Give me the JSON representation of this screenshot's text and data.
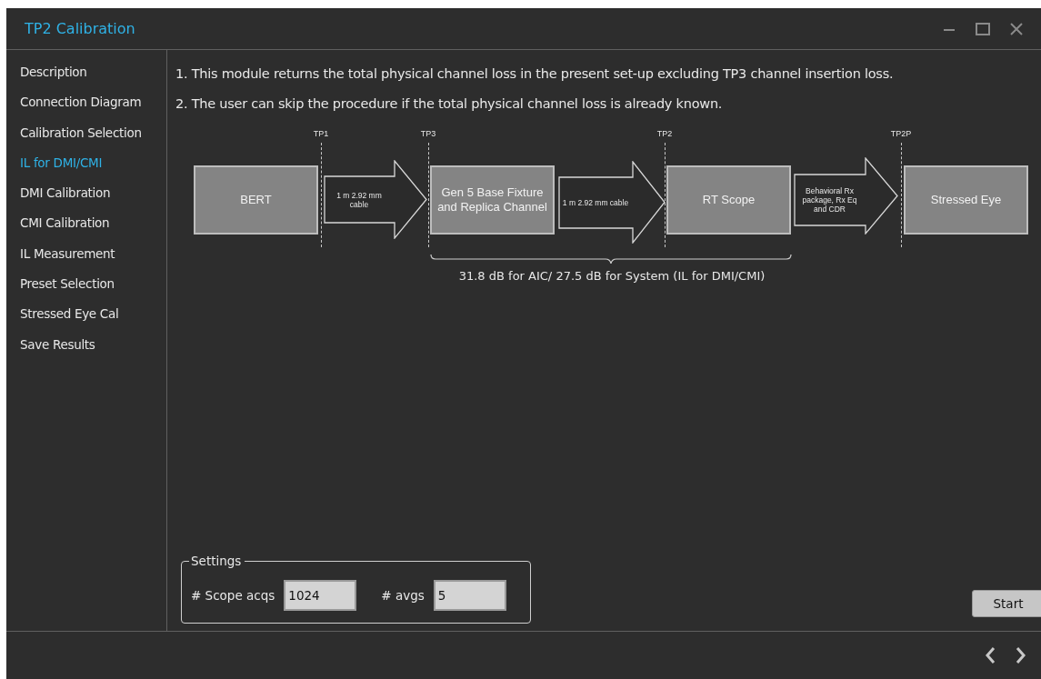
{
  "window": {
    "title": "TP2 Calibration"
  },
  "sidebar": {
    "items": [
      {
        "label": "Description",
        "selected": false
      },
      {
        "label": "Connection Diagram",
        "selected": false
      },
      {
        "label": "Calibration Selection",
        "selected": false
      },
      {
        "label": "IL for DMI/CMI",
        "selected": true
      },
      {
        "label": "DMI Calibration",
        "selected": false
      },
      {
        "label": "CMI Calibration",
        "selected": false
      },
      {
        "label": "IL Measurement",
        "selected": false
      },
      {
        "label": "Preset Selection",
        "selected": false
      },
      {
        "label": "Stressed Eye Cal",
        "selected": false
      },
      {
        "label": "Save Results",
        "selected": false
      }
    ]
  },
  "instructions": [
    "1. This module returns the total physical channel loss in the present set-up excluding TP3 channel insertion loss.",
    "2. The user can skip the procedure if the total physical channel loss is already known."
  ],
  "diagram": {
    "test_points": [
      "TP1",
      "TP3",
      "TP2",
      "TP2P"
    ],
    "blocks": [
      "BERT",
      "Gen 5 Base Fixture and Replica Channel",
      "RT Scope",
      "Stressed Eye"
    ],
    "connectors": [
      "1 m 2.92 mm cable",
      "1 m 2.92 mm cable",
      "Behavioral Rx package, Rx Eq and CDR"
    ],
    "brace_caption": "31.8 dB for AIC/ 27.5 dB for System (IL for DMI/CMI)"
  },
  "settings": {
    "legend": "Settings",
    "fields": [
      {
        "label": "# Scope acqs",
        "value": "1024"
      },
      {
        "label": "# avgs",
        "value": "5"
      }
    ]
  },
  "start_button": "Start"
}
